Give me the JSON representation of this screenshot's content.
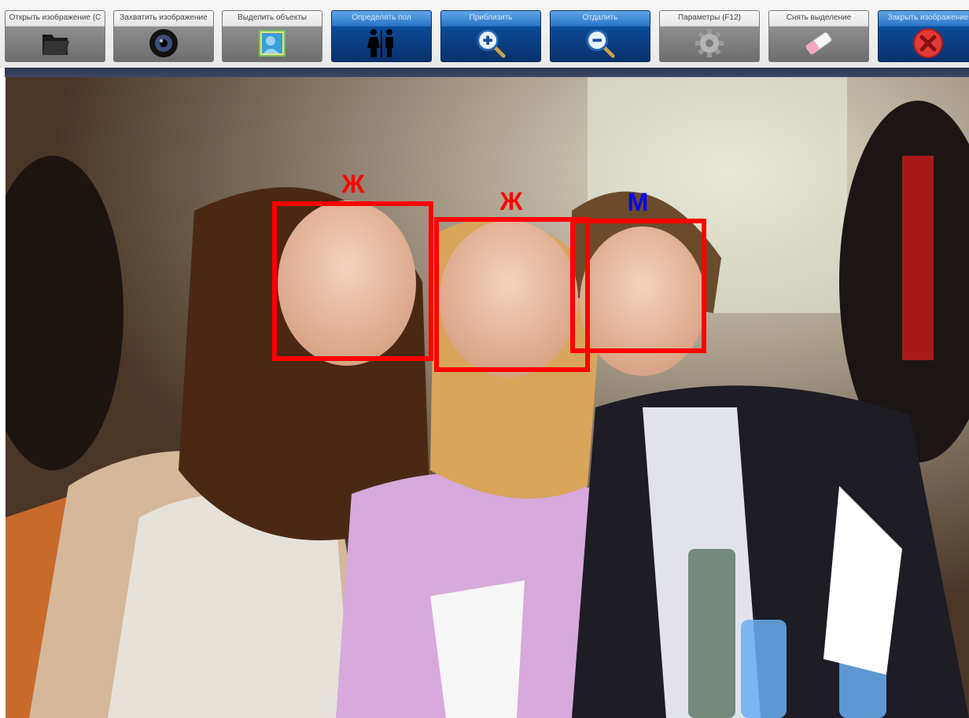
{
  "toolbar": {
    "buttons": [
      {
        "label": "Открыть изображение (C",
        "icon": "folder-icon",
        "active": false
      },
      {
        "label": "Захватить изображение",
        "icon": "webcam-icon",
        "active": false
      },
      {
        "label": "Выделить объекты",
        "icon": "portrait-icon",
        "active": false
      },
      {
        "label": "Определять пол",
        "icon": "gender-icon",
        "active": true
      },
      {
        "label": "Приблизить",
        "icon": "zoom-in-icon",
        "active": true
      },
      {
        "label": "Отдалить",
        "icon": "zoom-out-icon",
        "active": true
      },
      {
        "label": "Параметры (F12)",
        "icon": "gear-icon",
        "active": false
      },
      {
        "label": "Снять выделение",
        "icon": "eraser-icon",
        "active": false
      },
      {
        "label": "Закрыть изображение",
        "icon": "close-icon",
        "active": true
      }
    ]
  },
  "detections": [
    {
      "gender": "Ж"
    },
    {
      "gender": "Ж"
    },
    {
      "gender": "М"
    }
  ],
  "colors": {
    "box": "#ff0000",
    "female_label": "#ff0000",
    "male_label": "#0000ff",
    "active_button": "#0b4c98"
  }
}
